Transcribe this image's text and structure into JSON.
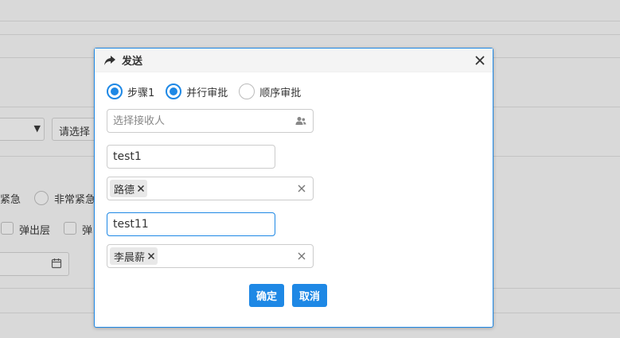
{
  "background": {
    "select_button": "请选择",
    "radio_urgent": "紧急",
    "radio_very_urgent": "非常紧急",
    "check_popup": "弹出层",
    "check_partial": "弹"
  },
  "dialog": {
    "title": "发送",
    "icon": "share-arrow-icon",
    "radios": [
      {
        "label": "步骤1",
        "checked": true
      },
      {
        "label": "并行审批",
        "checked": true
      },
      {
        "label": "顺序审批",
        "checked": false
      }
    ],
    "receiver_placeholder": "选择接收人",
    "groups": [
      {
        "name": "test1",
        "tags": [
          "路德"
        ]
      },
      {
        "name": "test11",
        "tags": [
          "李晨薪"
        ]
      }
    ],
    "confirm_label": "确定",
    "cancel_label": "取消"
  },
  "colors": {
    "accent": "#1e88e5",
    "overlay": "#d9d9d9"
  }
}
